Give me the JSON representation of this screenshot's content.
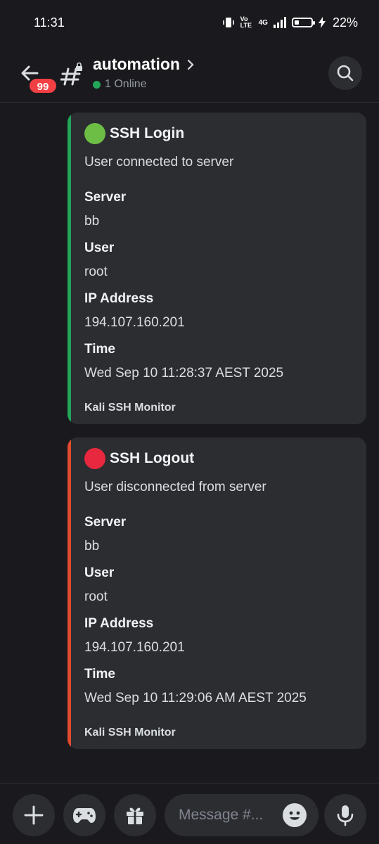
{
  "status_bar": {
    "time": "11:31",
    "battery_percent": "22%",
    "battery_level": 0.22,
    "network": "4G",
    "volte": "Vo LTE"
  },
  "header": {
    "unread_badge": "99",
    "channel_name": "automation",
    "online_text": "1 Online",
    "icons": [
      "back-arrow-icon",
      "locked-hash-icon",
      "chevron-right-icon",
      "search-icon"
    ]
  },
  "messages": [
    {
      "title": "SSH Login",
      "status_color": "#6dbe45",
      "bar_color": "#23a55a",
      "description": "User connected to server",
      "fields": [
        {
          "name": "Server",
          "value": "bb"
        },
        {
          "name": "User",
          "value": "root"
        },
        {
          "name": "IP Address",
          "value": "194.107.160.201"
        },
        {
          "name": "Time",
          "value": "Wed Sep 10 11:28:37 AEST 2025"
        }
      ],
      "footer": "Kali SSH Monitor"
    },
    {
      "title": "SSH Logout",
      "status_color": "#e8283f",
      "bar_color": "#e24b2e",
      "description": "User disconnected from server",
      "fields": [
        {
          "name": "Server",
          "value": "bb"
        },
        {
          "name": "User",
          "value": "root"
        },
        {
          "name": "IP Address",
          "value": "194.107.160.201"
        },
        {
          "name": "Time",
          "value": "Wed Sep 10 11:29:06 AM AEST 2025"
        }
      ],
      "footer": "Kali SSH Monitor"
    }
  ],
  "composer": {
    "placeholder": "Message #...",
    "icons": [
      "plus-icon",
      "gamepad-icon",
      "gift-icon",
      "emoji-icon",
      "microphone-icon"
    ]
  }
}
